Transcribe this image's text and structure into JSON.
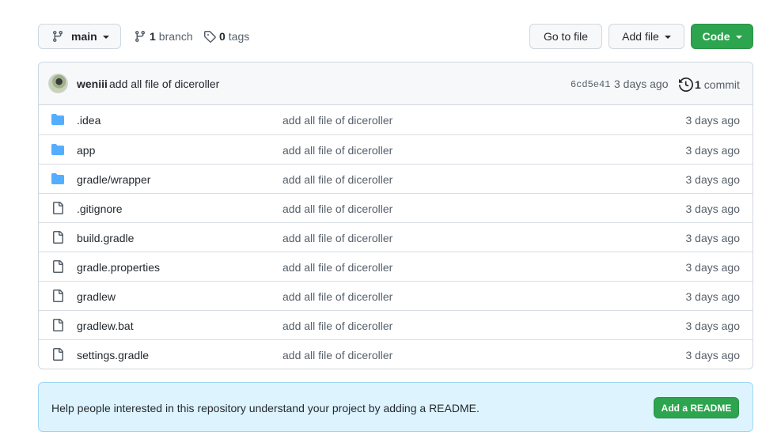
{
  "toolbar": {
    "branch_label": "main",
    "branches_count": "1",
    "branches_label": "branch",
    "tags_count": "0",
    "tags_label": "tags",
    "go_to_file_label": "Go to file",
    "add_file_label": "Add file",
    "code_label": "Code"
  },
  "commit": {
    "author": "weniii",
    "message": "add all file of diceroller",
    "sha": "6cd5e41",
    "time": "3 days ago",
    "count": "1",
    "count_label": "commit"
  },
  "files": [
    {
      "type": "folder",
      "name": ".idea",
      "message": "add all file of diceroller",
      "time": "3 days ago"
    },
    {
      "type": "folder",
      "name": "app",
      "message": "add all file of diceroller",
      "time": "3 days ago"
    },
    {
      "type": "folder",
      "name": "gradle/wrapper",
      "message": "add all file of diceroller",
      "time": "3 days ago"
    },
    {
      "type": "file",
      "name": ".gitignore",
      "message": "add all file of diceroller",
      "time": "3 days ago"
    },
    {
      "type": "file",
      "name": "build.gradle",
      "message": "add all file of diceroller",
      "time": "3 days ago"
    },
    {
      "type": "file",
      "name": "gradle.properties",
      "message": "add all file of diceroller",
      "time": "3 days ago"
    },
    {
      "type": "file",
      "name": "gradlew",
      "message": "add all file of diceroller",
      "time": "3 days ago"
    },
    {
      "type": "file",
      "name": "gradlew.bat",
      "message": "add all file of diceroller",
      "time": "3 days ago"
    },
    {
      "type": "file",
      "name": "settings.gradle",
      "message": "add all file of diceroller",
      "time": "3 days ago"
    }
  ],
  "banner": {
    "text": "Help people interested in this repository understand your project by adding a README.",
    "button_label": "Add a README"
  },
  "colors": {
    "primary_button": "#2da44e",
    "folder_icon": "#54aeff",
    "banner_bg": "#ddf4ff"
  },
  "icons": {
    "branch": "git-branch-icon",
    "tag": "tag-icon",
    "history": "history-icon",
    "folder": "folder-icon",
    "file": "file-icon"
  }
}
